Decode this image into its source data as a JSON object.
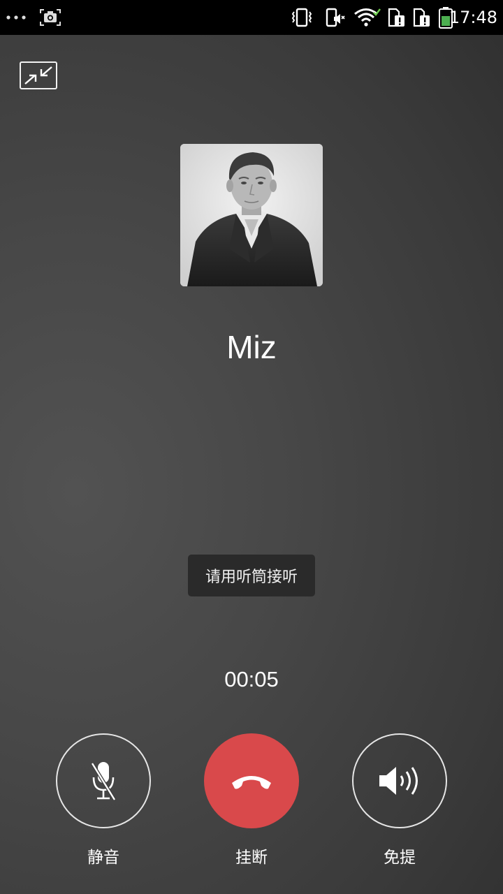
{
  "status_bar": {
    "time": "17:48",
    "icons": [
      "more-dots-icon",
      "screenshot-camera-icon",
      "vibrate-icon",
      "phone-mute-icon",
      "wifi-icon",
      "sim1-alert-icon",
      "sim2-alert-icon",
      "battery-icon"
    ],
    "battery_color": "#4caf50"
  },
  "call": {
    "contact_name": "Miz",
    "toast": "请用听筒接听",
    "duration": "00:05"
  },
  "controls": {
    "mute_label": "静音",
    "hangup_label": "挂断",
    "speaker_label": "免提",
    "hangup_color": "#d9494b"
  }
}
